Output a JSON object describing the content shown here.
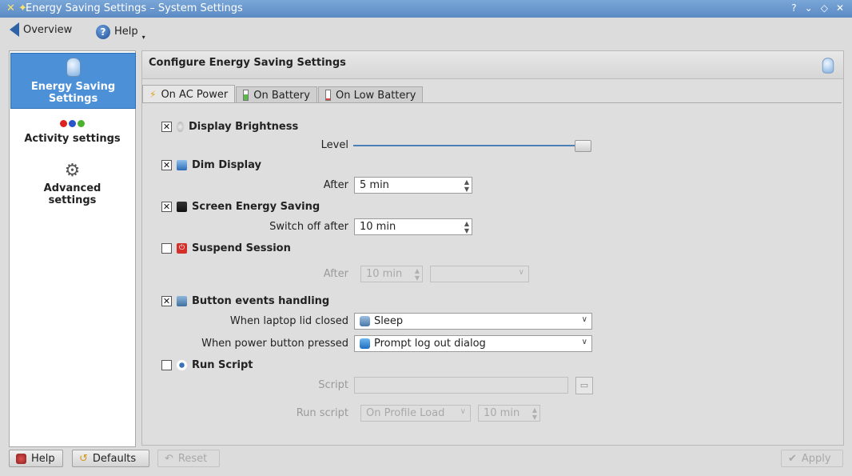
{
  "window": {
    "title": "Energy Saving Settings – System Settings",
    "controls": [
      "?",
      "⌄",
      "◇",
      "✕"
    ]
  },
  "toolbar": {
    "overview_label": "Overview",
    "help_label": "Help"
  },
  "sidebar": {
    "items": [
      {
        "label_line1": "Energy Saving",
        "label_line2": "Settings",
        "icon": "lightbulb-icon"
      },
      {
        "label_line1": "Activity settings",
        "icon": "activity-dots-icon"
      },
      {
        "label_line1": "Advanced",
        "label_line2": "settings",
        "icon": "wrench-gear-icon"
      }
    ]
  },
  "panel": {
    "title": "Configure Energy Saving Settings"
  },
  "tabs": [
    {
      "label": "On AC Power",
      "icon": "ac-power-icon"
    },
    {
      "label": "On Battery",
      "icon": "battery-icon"
    },
    {
      "label": "On Low Battery",
      "icon": "low-battery-icon"
    }
  ],
  "sections": {
    "brightness": {
      "title": "Display Brightness",
      "checked": "✕",
      "level_label": "Level",
      "level_value": 1.0
    },
    "dim": {
      "title": "Dim Display",
      "checked": "✕",
      "after_label": "After",
      "after_value": "5 min"
    },
    "screen": {
      "title": "Screen Energy Saving",
      "checked": "✕",
      "switch_label": "Switch off after",
      "switch_value": "10 min"
    },
    "suspend": {
      "title": "Suspend Session",
      "checked": "",
      "after_label": "After",
      "after_value": "10 min",
      "mode_value": ""
    },
    "buttons": {
      "title": "Button events handling",
      "checked": "✕",
      "lid_label": "When laptop lid closed",
      "lid_value": "Sleep",
      "power_label": "When power button pressed",
      "power_value": "Prompt log out dialog"
    },
    "script": {
      "title": "Run Script",
      "checked": "",
      "script_label": "Script",
      "script_value": "",
      "run_label": "Run script",
      "run_value": "On Profile Load",
      "run_after_value": "10 min"
    }
  },
  "footer": {
    "help_label": "Help",
    "defaults_label": "Defaults",
    "reset_label": "Reset",
    "apply_label": "Apply"
  },
  "colors": {
    "selection": "#4c90d8",
    "titlebar": "#6a98cf"
  }
}
